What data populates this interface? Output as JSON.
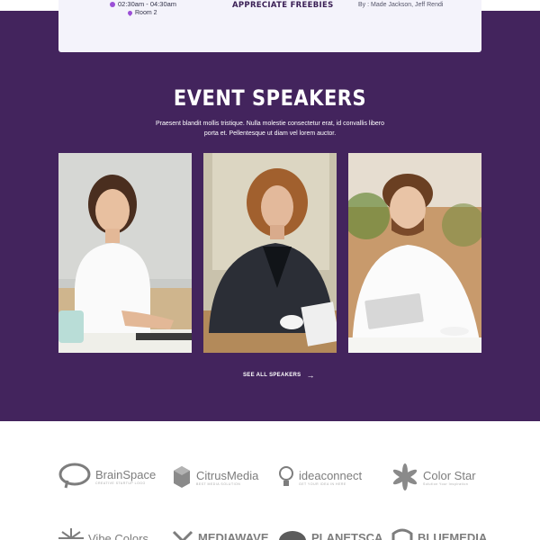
{
  "event": {
    "time": "02:30am - 04:30am",
    "room": "Room 2",
    "title": "APPRECIATE FREEBIES",
    "speakers": "By : Made Jackson, Jeff Rendi"
  },
  "speakers_section": {
    "title": "EVENT SPEAKERS",
    "description": "Praesent blandit mollis tristique. Nulla molestie consectetur erat, id convallis libero porta et. Pellentesque ut diam vel lorem auctor.",
    "see_all_label": "SEE ALL SPEAKERS"
  },
  "sponsors": {
    "logos": [
      {
        "name": "BrainSpace",
        "tagline": "CREATIVE STARTUP LOGO",
        "icon": "brain-icon"
      },
      {
        "name": "CitrusMedia",
        "tagline": "BEST MEDIA SOLUTION",
        "icon": "cube-icon"
      },
      {
        "name": "ideaconnect",
        "tagline": "GET YOUR IDEA IN HERE",
        "icon": "lightbulb-icon"
      },
      {
        "name": "Color Star",
        "tagline": "Solution Your Inspiration",
        "icon": "star-petals-icon"
      },
      {
        "name": "Vibe Colors",
        "icon": "burst-icon"
      },
      {
        "name": "MEDIAWAVE",
        "icon": "chevron-icon"
      },
      {
        "name": "PLANETSCA",
        "icon": "planet-icon"
      },
      {
        "name": "BLUEMEDIA",
        "icon": "wave-icon"
      }
    ]
  },
  "colors": {
    "section_bg": "#43245d",
    "accent": "#9b4fd6",
    "card_bg": "#f4f3fb"
  }
}
